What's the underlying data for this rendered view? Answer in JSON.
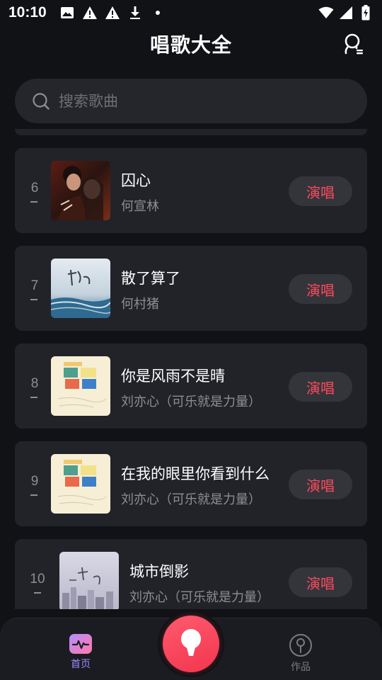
{
  "status_bar": {
    "time": "10:10",
    "left_icons": [
      "image-icon",
      "warning-icon",
      "warning-icon",
      "download-icon",
      "dot-icon"
    ],
    "right_icons": [
      "wifi-icon",
      "signal-icon",
      "battery-icon"
    ]
  },
  "header": {
    "title": "唱歌大全",
    "profile_icon": "user-icon"
  },
  "search": {
    "placeholder": "搜索歌曲",
    "icon": "search-icon"
  },
  "songs": [
    {
      "rank": "6",
      "title": "囚心",
      "artist": "何宣林",
      "button": "演唱"
    },
    {
      "rank": "7",
      "title": "散了算了",
      "artist": "何村猪",
      "button": "演唱"
    },
    {
      "rank": "8",
      "title": "你是风雨不是晴",
      "artist": "刘亦心（可乐就是力量）",
      "button": "演唱"
    },
    {
      "rank": "9",
      "title": "在我的眼里你看到什么",
      "artist": "刘亦心（可乐就是力量）",
      "button": "演唱"
    },
    {
      "rank": "10",
      "title": "城市倒影",
      "artist": "刘亦心（可乐就是力量）",
      "button": "演唱"
    }
  ],
  "bottom_nav": {
    "home_label": "首页",
    "works_label": "作品",
    "home_icon": "pulse-icon",
    "works_icon": "mic-outline-icon",
    "center_icon": "microphone-icon"
  },
  "colors": {
    "background": "#111216",
    "card": "#222329",
    "accent_red": "#ff4a5c",
    "active_nav": "#9a8cff"
  }
}
